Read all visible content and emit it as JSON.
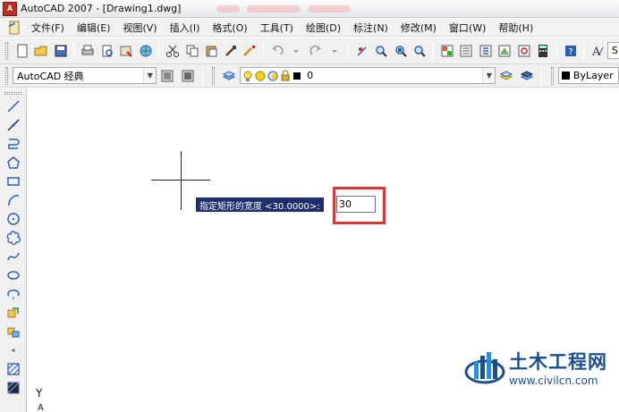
{
  "title_bar": {
    "logo_text": "A",
    "title": "AutoCAD 2007 - [Drawing1.dwg]"
  },
  "menu": {
    "items": [
      "文件(F)",
      "编辑(E)",
      "视图(V)",
      "插入(I)",
      "格式(O)",
      "工具(T)",
      "绘图(D)",
      "标注(N)",
      "修改(M)",
      "窗口(W)",
      "帮助(H)"
    ]
  },
  "toolbar": {
    "text_style_letter": "S",
    "workspace_value": "AutoCAD 经典",
    "layer_value": "0",
    "color_value": "ByLayer"
  },
  "canvas": {
    "prompt_text": "指定矩形的宽度 <30.0000>:",
    "input_value": "30",
    "ucs_y_label": "Y",
    "ucs_arrow": "A"
  },
  "watermark": {
    "main_text": "土木工程网",
    "url_text": "www.civilcn.com"
  },
  "colors": {
    "prompt_bg": "#1e2f6b",
    "highlight": "#d8383a",
    "watermark": "#1d4f8f"
  }
}
